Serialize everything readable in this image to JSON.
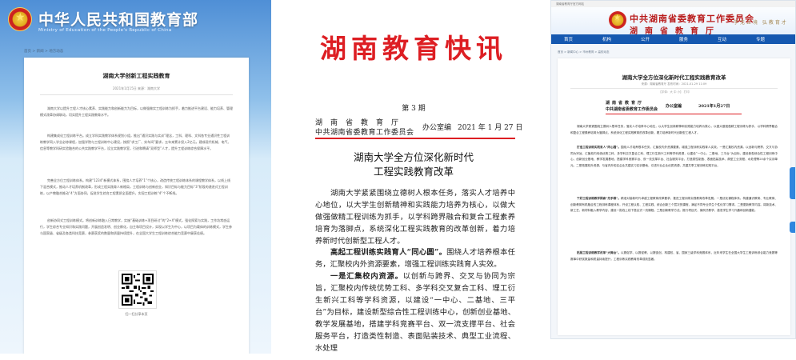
{
  "moe": {
    "site_title": "中华人民共和国教育部",
    "site_subtitle": "Ministry of Education of the People's Republic of China",
    "breadcrumb": "首页 > 新闻 > 地方动态",
    "article_title": "湖南大学创新工程实践教育",
    "article_meta": "2021年1月15日    来源：湖南大学",
    "paragraphs": [
      "湖南大学以提升工程人才核心素养、实践能力和创新能力为目标，以做强做实工程训练为抓手，着力推进平台建设、能力培养、管理模式改革协调联动，切实提升工程实践教育水平。",
      "构建集成化工程训练平台。成立学科实践教学体系规划小组，推出“通识实践与实训”理念，工科、理科、文科各专业通识性工程训练教学同入学业必修课程，加强学院与工程训练中心建设，按照“求工厂、实车间”要求，五年来累计投入2亿元，建成现代机械、电气、信息等教学科研实验融合的公共实践教学平台，设立实践教学室，引进和聘请“双师型”人才，提升工程训练综合保障水平。",
      "完善全方位工程训练体系。构建“1234”新模式体系，围绕人才培养“1”个核心，改造传统工程训练体系的课程教学体系，以线上线下混合模式，推动人才培养机制改革，形成工程实践育人新格局，工程训练与创新创业，知识目标与能力目标“3”阶段的递进式工程训练，以产教融合推动“4”方面协同，促进学生综合工程素质全面提升，实现工程训练“4”个不断线。",
      "创新协同式工程训练模式。将创新训练融入日常教学，实施“基础训练+项目研讨”的“2+X”模式，强化探索与实践，工作坊常态运行，学生综合专业知识和实践问题，开展创造发明、创业孵化，自主和项目设计，实现以学生为中心，以项目为载体的训练模式，学生参与国家级、省级及各类科技竞赛，参赛获奖的数量和质量持续提升，在全国大学生工程训练综合能力竞赛中屡获佳绩。"
    ],
    "qr_caption": "扫一扫分享本页"
  },
  "bulletin": {
    "masthead": "湖南教育快讯",
    "issue": "第 3 期",
    "org_line1": "湖南省教育厅",
    "org_line2": "中共湖南省委教育工作委员会",
    "office": "办公室编",
    "date": "2021 年 1 月 27 日",
    "title_line1": "湖南大学全方位深化新时代",
    "title_line2": "工程实践教育改革",
    "para1": "湖南大学紧紧围绕立德树人根本任务，落实人才培养中心地位，以大学生创新精神和实践能力培养为核心，以做大做强做精工程训练为抓手，以学科跨界融合和复合工程素养培育为落脚点，系统深化工程实践教育的改革创新，着力培养新时代创新型工程人才。",
    "para2_bold": "高起工程训练实践育人“同心圆”。",
    "para2": "围绕人才培养根本任务，汇聚校内外资源要素，增强工程训练实践育人实效。",
    "para3_bold": "一是汇集校内资源。",
    "para3": "以创新与跨界、交叉与协同为宗旨，汇聚校内传统优势工科、多学科交叉复合工科、理工衍生新兴工科等学科资源，以建设“一中心、二基地、三平台”为目标，建设新型综合性工程训练中心，创新创业基地、教学发展基地，搭建学科竞赛平台、双一流支撑平台、社会服务平台，打造类性制造、表面贴装技术、典型工业流程、水处理"
  },
  "hunan": {
    "topbar": "湖南省教育厅官方网站",
    "site_name1": "中共湖南省委教育工作委员会",
    "site_name2": "湖南省教育厅",
    "slogan": "学无止境  弘教育才",
    "nav": [
      "首页",
      "机构",
      "公开",
      "服务",
      "互动",
      "专题"
    ],
    "breadcrumb": "首页 > 新闻中心 > 市州教育 > 高校动态",
    "article_title": "湖南大学全方位深化新时代工程实践教育改革",
    "article_meta": "来源：湖南省教育厅    发布时间：2021-01-29 11:09",
    "tools": "【字体：大 中 小】  打印",
    "mini_org1": "湖南省教育厅",
    "mini_org2": "中共湖南省委教育工作委员会",
    "mini_office": "办公室编",
    "mini_date": "2021年1月27日",
    "para1": "湖南大学紧紧围绕立德树人根本任务，落实人才培养中心地位，以大学生创新精神和实践能力培养为核心，以做大做强做精工程训练为抓手，以学科跨界融合和复合工程素养培育为落脚点，系统深化工程实践教育的改革创新，着力培养新时代创新型工程人才。",
    "para2_bold": "打造工程训练实践育人“同心圆”。",
    "para2": "围绕人才培养根本任务，汇聚校内外资源要素，增强工程训练实践育人实效。一是汇集校内资源。以创新与跨界、交叉与协同为宗旨，汇聚校内传统优势工科、多学科交叉复合工科、理工衍生新兴工科等学科资源，以建设“一中心、二基地、三平台”为目标，建设新型综合性工程训练中心，创新创业基地、教学发展基地，搭建学科竞赛平台、双一流支撑平台、社会服务平台，打造类性制造、表面贴装技术、典型工业流程、水处理等20余个实训单元。二是拓展校外资源。与省内外知名企业共建实习实训基地，引进行业企业优质资源，共建共享工程训练实践平台。",
    "para3_bold": "下好工程训练教学探索“先手棋”。",
    "para3": "精准对接新时代卓越工程教育改革要求，推进工程训练实践教育改革发展。一是优化课程体系。构建通识教育、专业教育、创新教育有机融合的工程训练课程体系，开设工程认知、工程实践、综合创新三个层次的课程，满足不同专业学生个性化学习需求。二是更新教学内容。将新技术、新工艺、新材料融入教学内容，建设一批线上线下混合式一流课程。三是创新教学方法。推行项目式、案例式教学，激发学生学习兴趣和创新潜能。",
    "para4_bold": "拓展工程训练教学改革“大舞台”。",
    "para4": "以赛促学、以赛促教、以赛促创，构建校、省、国家三级学科竞赛体系，近年来学生在全国大学生工程训练综合能力竞赛等赛事中获奖数量和质量持续提升，工程训练实践教育改革成效显著。"
  }
}
